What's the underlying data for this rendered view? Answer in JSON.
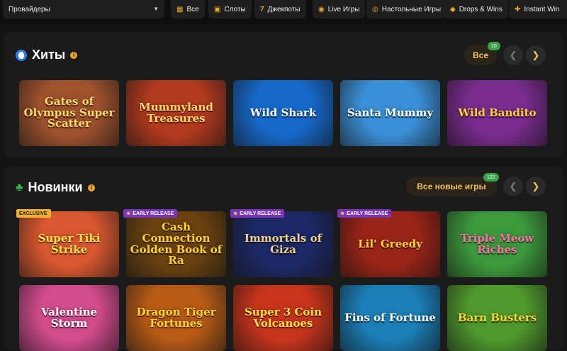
{
  "filters": {
    "provider_placeholder": "Провайдеры",
    "categories": [
      {
        "label": "Все",
        "icon": "grid-icon"
      },
      {
        "label": "Слоты",
        "icon": "slot-machine-icon"
      },
      {
        "label": "Джекпоты",
        "icon": "seven-icon"
      },
      {
        "label": "Live Игры",
        "icon": "live-icon"
      },
      {
        "label": "Настольные Игры",
        "icon": "chip-icon"
      },
      {
        "label": "Drops & Wins",
        "icon": "drops-icon"
      },
      {
        "label": "Instant Win",
        "icon": "gamepad-icon"
      }
    ]
  },
  "hits": {
    "title": "Хиты",
    "all_label": "Все",
    "count": "10",
    "games": [
      {
        "title": "Gates of Olympus Super Scatter",
        "bg": "#a0522d"
      },
      {
        "title": "Mummyland Treasures",
        "bg": "#b23a1f"
      },
      {
        "title": "Wild Shark",
        "bg": "#1669c9"
      },
      {
        "title": "Santa Mummy",
        "bg": "#3a8fd6"
      },
      {
        "title": "Wild Bandito",
        "bg": "#7a2c8f"
      }
    ]
  },
  "new": {
    "title": "Новинки",
    "all_label": "Все новые игры",
    "count": "122",
    "games": [
      {
        "title": "Super Tiki Strike",
        "bg": "#d8582f",
        "badge": "EXCLUSIVE",
        "badge_type": "exclusive"
      },
      {
        "title": "Cash Connection Golden Book of Ra",
        "bg": "#6a4210",
        "badge": "EARLY RELEASE",
        "badge_type": "early"
      },
      {
        "title": "Immortals of Giza",
        "bg": "#1c2966",
        "badge": "EARLY RELEASE",
        "badge_type": "early"
      },
      {
        "title": "Lil' Greedy",
        "bg": "#9a2418",
        "badge": "EARLY RELEASE",
        "badge_type": "early"
      },
      {
        "title": "Triple Meow Riches",
        "bg": "#3c9a3c"
      },
      {
        "title": "Valentine Storm",
        "bg": "#d34c8e"
      },
      {
        "title": "Dragon Tiger Fortunes",
        "bg": "#b85b16"
      },
      {
        "title": "Super 3 Coin Volcanoes",
        "bg": "#c8341c"
      },
      {
        "title": "Fins of Fortune",
        "bg": "#1b7fb8"
      },
      {
        "title": "Barn Busters",
        "bg": "#4f9a2c"
      }
    ]
  },
  "colors": {
    "accent": "#f3c15c",
    "badge_green": "#3aa24a",
    "early_release": "#7b33b8",
    "exclusive": "#f0b12e"
  }
}
